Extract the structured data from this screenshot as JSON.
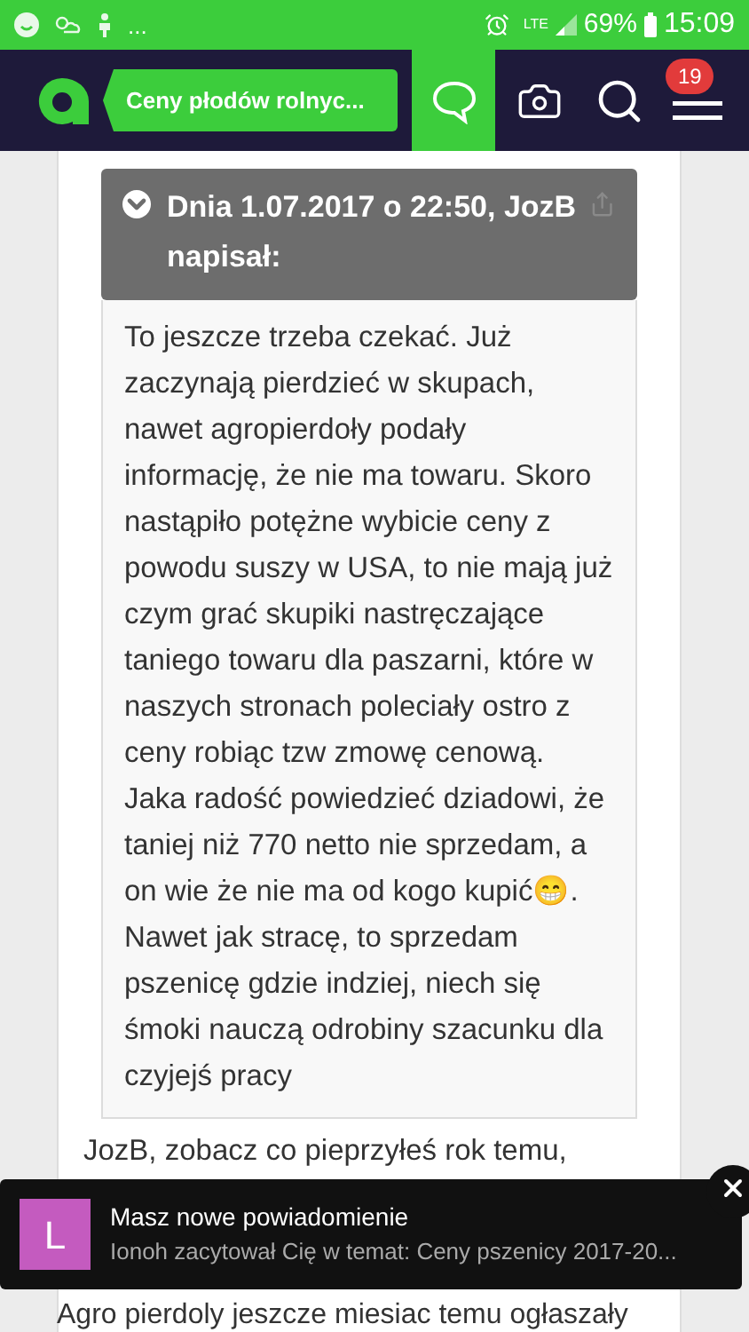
{
  "status_bar": {
    "dots": "...",
    "network": "LTE",
    "battery": "69%",
    "time": "15:09"
  },
  "nav": {
    "topic": "Ceny płodów rolnyc...",
    "notification_count": "19"
  },
  "quote": {
    "header": "Dnia 1.07.2017 o 22:50, JozB napisał:",
    "text": "To jeszcze trzeba czekać. Już zaczynają pierdzieć w skupach, nawet agropierdoły podały informację, że nie ma towaru. Skoro nastąpiło potężne wybicie ceny z powodu suszy w USA, to nie mają już czym grać skupiki nastręczające taniego towaru dla paszarni, które w naszych stronach poleciały ostro z ceny robiąc tzw zmowę cenową. Jaka radość powiedzieć dziadowi, że taniej niż 770 netto nie sprzedam, a on wie że nie ma od kogo kupić😁. Nawet jak stracę, to sprzedam pszenicę gdzie indziej, niech się śmoki nauczą odrobiny szacunku dla czyjejś pracy"
  },
  "reply": "JozB, zobacz co pieprzyłeś rok temu,",
  "toast": {
    "avatar": "L",
    "title": "Masz nowe powiadomienie",
    "message": "Ionoh zacytował Cię w temat: Ceny pszenicy 2017-20..."
  },
  "next_post": "Agro pierdoly jeszcze miesiac temu ogłaszały"
}
